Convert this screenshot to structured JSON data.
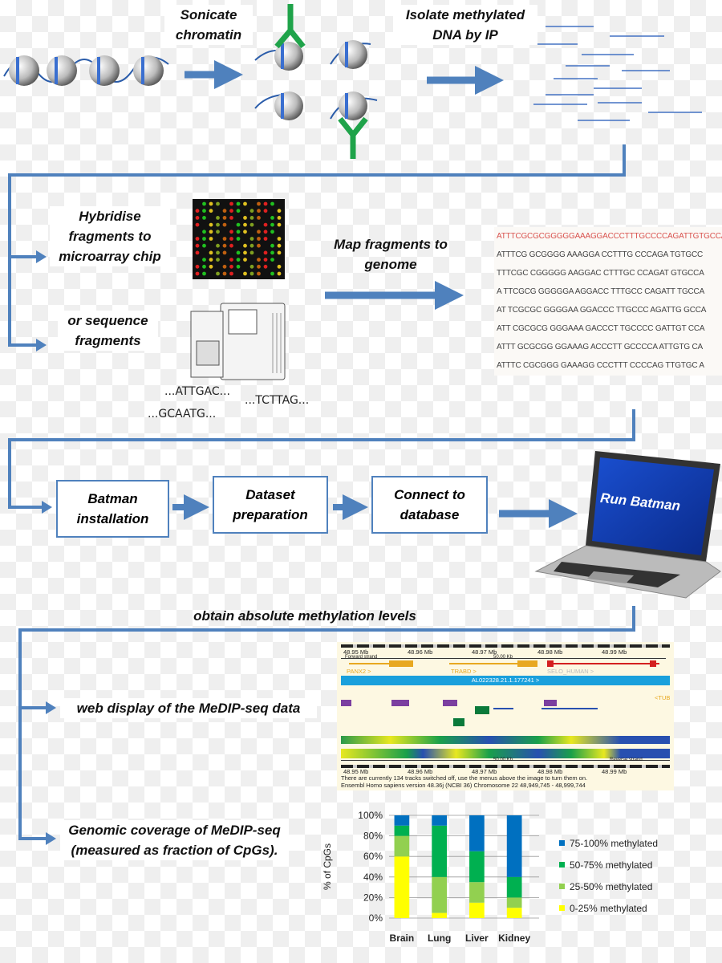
{
  "steps": {
    "sonicate": "Sonicate chromatin",
    "isolate": "Isolate methylated DNA by IP",
    "hybridise": "Hybridise fragments to microarray chip",
    "sequence": "or sequence fragments",
    "map": "Map fragments to genome",
    "batman_install": "Batman installation",
    "dataset_prep": "Dataset preparation",
    "connect_db": "Connect to database",
    "run_batman": "Run Batman",
    "obtain": "obtain absolute methylation levels",
    "web_display": "web display of the MeDIP-seq data",
    "coverage": "Genomic coverage of MeDIP-seq (measured as fraction of CpGs)."
  },
  "reads": [
    "...ATTGAC...",
    "...TCTTAG...",
    "...GCAATG..."
  ],
  "sequence_alignment": [
    "ATTTCGCGCGGGGGAAAGGACCCTTTGCCCCAGATTGTGCCA",
    "ATTTCG  GCGGGG AAAGGA  CCTTTG  CCCAGA  TGTGCC",
    "  TTTCGC  CGGGGG AAGGAC  CTTTGC  CCAGAT  GTGCCA",
    "A TTCGCG  GGGGGA  AGGACC  TTTGCC  CAGATT   TGCCA",
    "AT TCGCGC  GGGGAA  GGACCC  TTGCCC  AGATTG  GCCA",
    "ATT CGCGCG  GGGAAA  GACCCT  TGCCCC  GATTGT  CCA",
    "ATTT GCGCGG  GGAAAG  ACCCTT  GCCCCA  ATTGTG  CA",
    "ATTTC  CGCGGG  GAAAGG  CCCTTT  CCCCAG  TTGTGC  A"
  ],
  "ensembl": {
    "ticks": [
      "48.95 Mb",
      "48.96 Mb",
      "48.97 Mb",
      "48.98 Mb",
      "48.99 Mb"
    ],
    "forward_strand": "Forward strand",
    "scale": "50.00 Kb",
    "genes": [
      "PANX2 >",
      "TRABD >",
      "SELO_HUMAN >"
    ],
    "contig": "AL022328.21.1.177241 >",
    "tub": "<TUB",
    "reverse_strand": "Reverse strand",
    "footer1": "There are currently 134 tracks switched off, use the menus above the image to turn them on.",
    "footer2": "Ensembl Homo sapiens version 48.36j (NCBI 36) Chromosome 22 48,949,745 - 48,999,744"
  },
  "colors": {
    "arrow": "#4f81bd",
    "antibody": "#1fa34a",
    "line": "#4472c4"
  },
  "chart_data": {
    "type": "bar",
    "stacked": true,
    "categories": [
      "Brain",
      "Lung",
      "Liver",
      "Kidney"
    ],
    "ylabel": "% of CpGs",
    "ylim": [
      0,
      100
    ],
    "yticks": [
      "0%",
      "20%",
      "40%",
      "60%",
      "80%",
      "100%"
    ],
    "grid": true,
    "legend_position": "right",
    "series": [
      {
        "name": "0-25% methylated",
        "color": "#ffff00",
        "values": [
          60,
          5,
          15,
          10
        ]
      },
      {
        "name": "25-50% methylated",
        "color": "#92d050",
        "values": [
          20,
          35,
          20,
          10
        ]
      },
      {
        "name": "50-75% methylated",
        "color": "#00b050",
        "values": [
          10,
          50,
          30,
          20
        ]
      },
      {
        "name": "75-100% methylated",
        "color": "#0070c0",
        "values": [
          10,
          10,
          35,
          60
        ]
      }
    ]
  }
}
